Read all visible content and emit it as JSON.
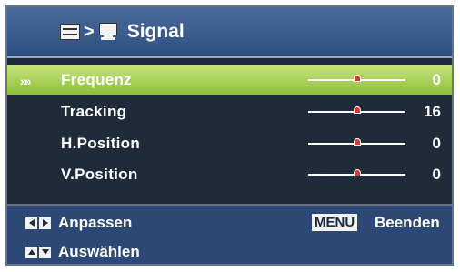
{
  "header": {
    "separator": ">",
    "title": "Signal",
    "menu_icon": "menu-icon",
    "monitor_icon": "monitor-icon"
  },
  "items": [
    {
      "label": "Frequenz",
      "value": "0",
      "selected": true,
      "slider_level": 0.5
    },
    {
      "label": "Tracking",
      "value": "16",
      "selected": false,
      "slider_level": 0.5
    },
    {
      "label": "H.Position",
      "value": "0",
      "selected": false,
      "slider_level": 0.5
    },
    {
      "label": "V.Position",
      "value": "0",
      "selected": false,
      "slider_level": 0.5
    }
  ],
  "selection_indicator": "»»",
  "footer": {
    "adjust_label": "Anpassen",
    "select_label": "Auswählen",
    "menu_key": "MENU",
    "exit_label": "Beenden"
  },
  "colors": {
    "background": "#1f2a3a",
    "header": "#3d5d90",
    "selected_row": "#a6cf55",
    "footer": "#2d4875",
    "slider_thumb": "#d93a2a"
  }
}
